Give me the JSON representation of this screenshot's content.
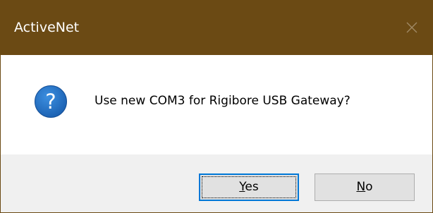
{
  "window": {
    "title": "ActiveNet",
    "close_icon": "close-icon"
  },
  "message": {
    "icon": "question-icon",
    "text": "Use new COM3 for Rigibore USB Gateway?"
  },
  "buttons": {
    "yes": {
      "mnemonic": "Y",
      "rest": "es",
      "default": true
    },
    "no": {
      "mnemonic": "N",
      "rest": "o",
      "default": false
    }
  },
  "colors": {
    "titlebar": "#6b4a14",
    "icon_blue": "#1f6fc5",
    "footer": "#f0f0f0",
    "accent_border": "#0078d7"
  }
}
